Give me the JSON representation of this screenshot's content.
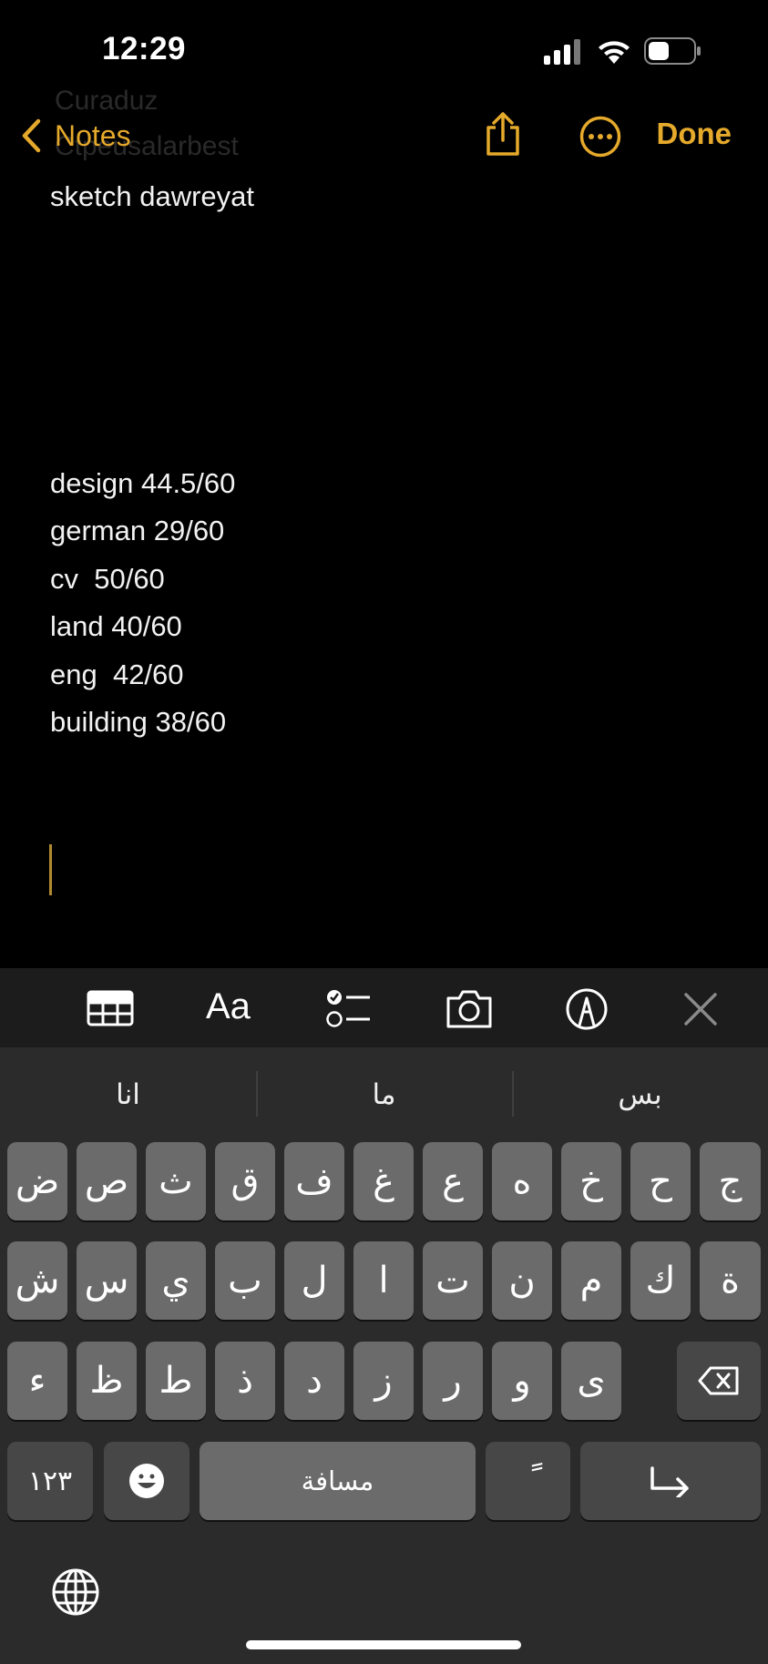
{
  "status_bar": {
    "time": "12:29"
  },
  "nav": {
    "back_label": "Notes",
    "done_label": "Done",
    "ghost_text_1": "Curaduz",
    "ghost_text_2": "Ctpeusalarbest"
  },
  "note": {
    "title": "sketch dawreyat",
    "lines": [
      "design 44.5/60",
      "german 29/60",
      "cv  50/60",
      "land 40/60",
      "eng  42/60",
      "building 38/60"
    ]
  },
  "toolbar": {
    "icons": [
      "table-icon",
      "format-icon",
      "checklist-icon",
      "camera-icon",
      "markup-icon",
      "close-icon"
    ],
    "format_label": "Aa"
  },
  "keyboard": {
    "suggestions": [
      "انا",
      "ما",
      "بس"
    ],
    "row1": [
      "ض",
      "ص",
      "ث",
      "ق",
      "ف",
      "غ",
      "ع",
      "ه",
      "خ",
      "ح",
      "ج"
    ],
    "row2": [
      "ش",
      "س",
      "ي",
      "ب",
      "ل",
      "ا",
      "ت",
      "ن",
      "م",
      "ك",
      "ة"
    ],
    "row3": [
      "ء",
      "ظ",
      "ط",
      "ذ",
      "د",
      "ز",
      "ر",
      "و",
      "ى"
    ],
    "numbers_label": "١٢٣",
    "space_label": "مسافة",
    "diacritic_label": "ً"
  },
  "colors": {
    "accent": "#e5a92b",
    "background": "#000000",
    "key": "#6b6b6b",
    "key_fn": "#474747",
    "keyboard_bg": "#2b2b2b"
  }
}
